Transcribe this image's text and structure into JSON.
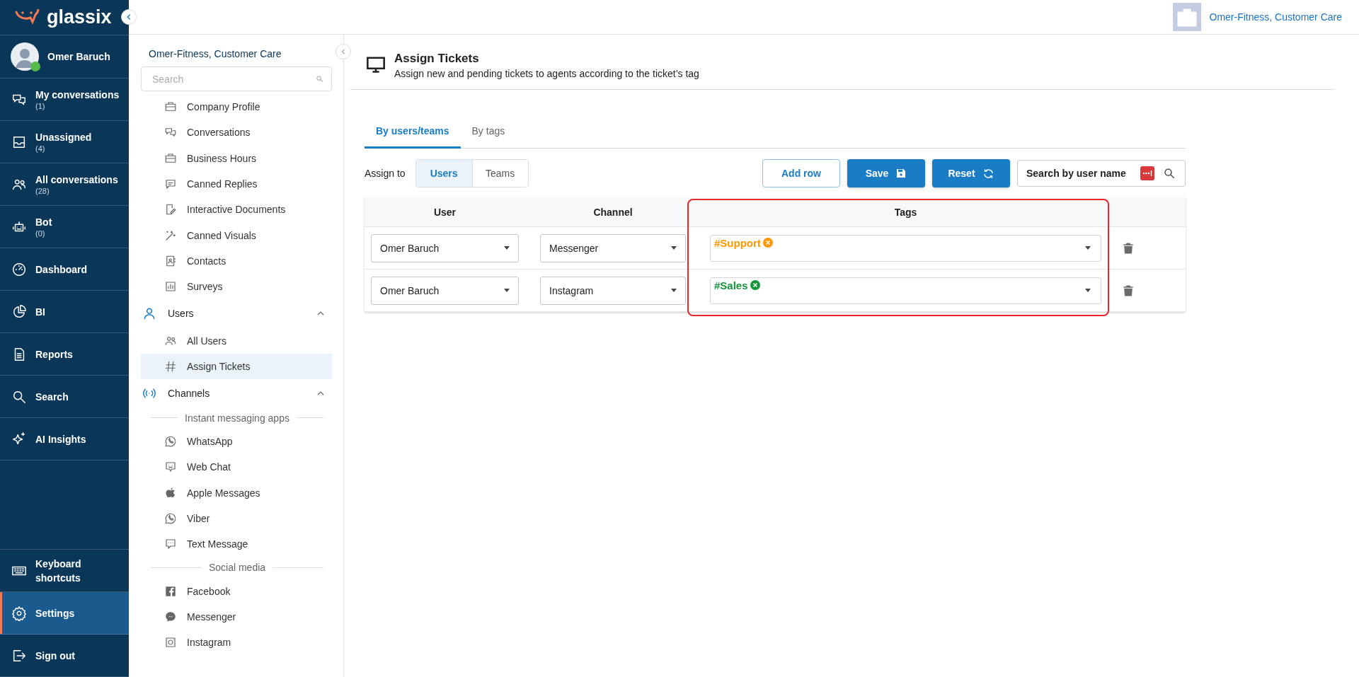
{
  "logo": {
    "text": "glassix"
  },
  "header": {
    "account": "Omer-Fitness, Customer Care"
  },
  "nav": {
    "user": {
      "name": "Omer Baruch",
      "online": true
    },
    "items": [
      {
        "label": "My conversations",
        "count": "(1)",
        "selected": false
      },
      {
        "label": "Unassigned",
        "count": "(4)",
        "selected": false
      },
      {
        "label": "All conversations",
        "count": "(28)",
        "selected": false
      },
      {
        "label": "Bot",
        "count": "(0)",
        "selected": false
      },
      {
        "label": "Dashboard",
        "selected": false
      },
      {
        "label": "BI",
        "selected": false
      },
      {
        "label": "Reports",
        "selected": false
      },
      {
        "label": "Search",
        "selected": false
      },
      {
        "label": "AI Insights",
        "selected": false
      }
    ],
    "bottom": [
      {
        "label": "Keyboard shortcuts",
        "selected": false
      },
      {
        "label": "Settings",
        "selected": true
      },
      {
        "label": "Sign out",
        "selected": false
      }
    ]
  },
  "settings_menu": {
    "title": "Omer-Fitness, Customer Care",
    "search": {
      "placeholder": "Search"
    },
    "items": [
      {
        "label": "Company Profile",
        "selected": false
      },
      {
        "label": "Conversations",
        "selected": false
      },
      {
        "label": "Business Hours",
        "selected": false
      },
      {
        "label": "Canned Replies",
        "selected": false
      },
      {
        "label": "Interactive Documents",
        "selected": false
      },
      {
        "label": "Canned Visuals",
        "selected": false
      },
      {
        "label": "Contacts",
        "selected": false
      },
      {
        "label": "Surveys",
        "selected": false
      }
    ],
    "groups": [
      {
        "label": "Users",
        "expanded": true,
        "children": [
          {
            "kind": "item",
            "label": "All Users",
            "selected": false
          },
          {
            "kind": "item",
            "label": "Assign Tickets",
            "selected": true
          }
        ]
      },
      {
        "label": "Channels",
        "expanded": true,
        "children": [
          {
            "kind": "heading",
            "label": "Instant messaging apps"
          },
          {
            "kind": "item",
            "label": "WhatsApp",
            "selected": false
          },
          {
            "kind": "item",
            "label": "Web Chat",
            "selected": false
          },
          {
            "kind": "item",
            "label": "Apple Messages",
            "selected": false
          },
          {
            "kind": "item",
            "label": "Viber",
            "selected": false
          },
          {
            "kind": "item",
            "label": "Text Message",
            "selected": false
          },
          {
            "kind": "heading",
            "label": "Social media"
          },
          {
            "kind": "item",
            "label": "Facebook",
            "selected": false
          },
          {
            "kind": "item",
            "label": "Messenger",
            "selected": false
          },
          {
            "kind": "item",
            "label": "Instagram",
            "selected": false
          }
        ]
      }
    ]
  },
  "page": {
    "title": "Assign Tickets",
    "subtitle": "Assign new and pending tickets to agents according to the ticket’s tag"
  },
  "tabs": [
    {
      "label": "By users/teams",
      "selected": true
    },
    {
      "label": "By tags",
      "selected": false
    }
  ],
  "toolbar": {
    "assign_label": "Assign to",
    "segments": [
      {
        "label": "Users",
        "selected": true
      },
      {
        "label": "Teams",
        "selected": false
      }
    ],
    "buttons": [
      {
        "kind": "outline",
        "label": "Add row"
      },
      {
        "kind": "save",
        "label": "Save"
      },
      {
        "kind": "reset",
        "label": "Reset"
      }
    ],
    "search": {
      "placeholder": "Search by user name"
    }
  },
  "table": {
    "columns": [
      "User",
      "Channel",
      "Tags"
    ],
    "rows": [
      {
        "user": "Omer Baruch",
        "channel": "Messenger",
        "tags": [
          {
            "label": "#Support",
            "color": "#ff9800"
          }
        ]
      },
      {
        "user": "Omer Baruch",
        "channel": "Instagram",
        "tags": [
          {
            "label": "#Sales",
            "color": "#16963a"
          }
        ]
      }
    ]
  }
}
